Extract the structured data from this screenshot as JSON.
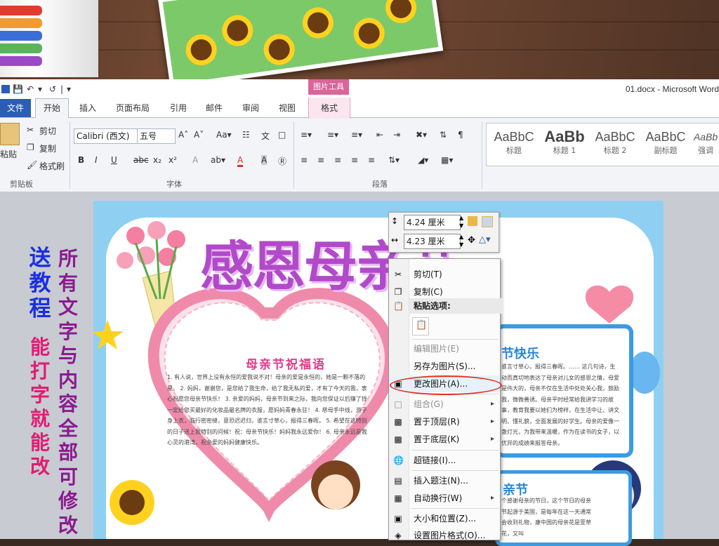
{
  "window": {
    "title": "01.docx  -  Microsoft Word"
  },
  "tabs": {
    "file": "文件",
    "home": "开始",
    "insert": "插入",
    "layout": "页面布局",
    "references": "引用",
    "mailings": "邮件",
    "review": "审阅",
    "view": "视图"
  },
  "context_tab": {
    "header": "图片工具",
    "format": "格式"
  },
  "clipboard": {
    "paste": "粘贴",
    "cut": "剪切",
    "copy": "复制",
    "format_painter": "格式刷",
    "group_label": "剪贴板"
  },
  "font": {
    "name": "Calibri (西文)",
    "size": "五号",
    "group_label": "字体"
  },
  "paragraph": {
    "group_label": "段落"
  },
  "styles": [
    {
      "sample": "AaBbC",
      "name": "标题"
    },
    {
      "sample": "AaBb",
      "name": "标题 1"
    },
    {
      "sample": "AaBbC",
      "name": "标题 2"
    },
    {
      "sample": "AaBbC",
      "name": "副标题"
    },
    {
      "sample": "AaBb",
      "name": "强调"
    }
  ],
  "size_toolbar": {
    "height": "4.24 厘米",
    "width": "4.23 厘米"
  },
  "context_menu": {
    "cut": "剪切(T)",
    "copy": "复制(C)",
    "paste_options": "粘贴选项:",
    "edit_picture": "编辑图片(E)",
    "save_as_picture": "另存为图片(S)...",
    "change_picture": "更改图片(A)...",
    "group": "组合(G)",
    "bring_to_front": "置于顶层(R)",
    "send_to_back": "置于底层(K)",
    "hyperlink": "超链接(I)...",
    "insert_caption": "插入题注(N)...",
    "wrap_text": "自动换行(W)",
    "size_position": "大小和位置(Z)...",
    "format_picture": "设置图片格式(O)..."
  },
  "document": {
    "big_title": "感恩母亲节",
    "blessing_title": "母亲节祝福语",
    "blessing_text": "1. 有人说，世界上没有永恒的爱我说不对！母亲的爱是永恒的，她是一颗不落的星。 2. 妈妈，谢谢您，是您给了我生命，给了我无私的爱，才有了今天的我，衷心祝愿您母亲节快乐！ 3. 亲爱的妈妈，母亲节到来之际，我向您保证以后赚了钱一定给您买最好的化妆品最名牌的衣服，愿妈妈青春永驻！ 4. 慈母手中线，游子身上衣，临行密密缝，意恐迟迟归，谁言寸草心，报得三春晖。 5. 希望在这特别的日子送上我特别的问候！祝：母亲节快乐！妈妈我永远爱你！ 6. 母亲永远是我心灵的港湾，祝亲爱的妈妈健康快乐。",
    "right_title": "节快乐",
    "right_text": "谁言寸草心，报得三春晖。…… 这几句诗，生动而真切地表达了母亲对儿女的感恩之情，母爱是伟大的，母亲不仅在生活中处处关心我，鼓励我，微微善诱。母亲平时经常给我讲学习的故事，教育我要以她们为榜样，在生活中让、讲文明、懂礼貌，全面发展的好学生。母亲的爱像一盏灯光，为我带来温暖，作为在读书的女子，以优异的成绩来报答母亲。",
    "right_title2": "亲节",
    "right_text2": "个感谢母亲的节日，这个节日的母亲节起源于美国，是每年在这一天通常会收到礼物，康中国的母亲花是萱草花，又叫"
  },
  "side_text": {
    "line1": "送教程",
    "line2": "能打字就能改",
    "line3": "所有文字与内容全部可修改"
  },
  "colors": {
    "accent": "#2a5db5",
    "context": "#d9659a",
    "title": "#b14ac9"
  }
}
